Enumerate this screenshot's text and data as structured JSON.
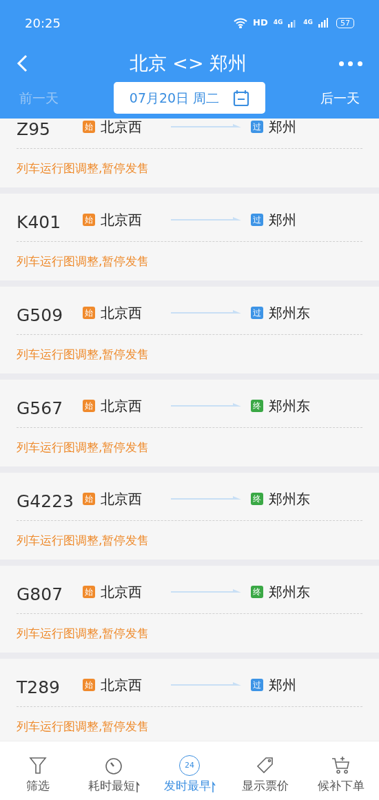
{
  "status_bar": {
    "time": "20:25",
    "hd": "HD",
    "network_1": "4G",
    "network_2": "4G",
    "battery": "57"
  },
  "header": {
    "title": "北京 <> 郑州"
  },
  "date_bar": {
    "prev": {
      "label": "前一天",
      "disabled": true
    },
    "date": "07月20日 周二",
    "next": {
      "label": "后一天",
      "disabled": false
    }
  },
  "trains": [
    {
      "number": "Z95",
      "from_badge": {
        "text": "始",
        "color": "#f08a2c"
      },
      "from": "北京西",
      "to_badge": {
        "text": "过",
        "color": "#3d94e6"
      },
      "to": "郑州",
      "note": "列车运行图调整,暂停发售"
    },
    {
      "number": "K401",
      "from_badge": {
        "text": "始",
        "color": "#f08a2c"
      },
      "from": "北京西",
      "to_badge": {
        "text": "过",
        "color": "#3d94e6"
      },
      "to": "郑州",
      "note": "列车运行图调整,暂停发售"
    },
    {
      "number": "G509",
      "from_badge": {
        "text": "始",
        "color": "#f08a2c"
      },
      "from": "北京西",
      "to_badge": {
        "text": "过",
        "color": "#3d94e6"
      },
      "to": "郑州东",
      "note": "列车运行图调整,暂停发售"
    },
    {
      "number": "G567",
      "from_badge": {
        "text": "始",
        "color": "#f08a2c"
      },
      "from": "北京西",
      "to_badge": {
        "text": "终",
        "color": "#3aa845"
      },
      "to": "郑州东",
      "note": "列车运行图调整,暂停发售"
    },
    {
      "number": "G4223",
      "from_badge": {
        "text": "始",
        "color": "#f08a2c"
      },
      "from": "北京西",
      "to_badge": {
        "text": "终",
        "color": "#3aa845"
      },
      "to": "郑州东",
      "note": "列车运行图调整,暂停发售"
    },
    {
      "number": "G807",
      "from_badge": {
        "text": "始",
        "color": "#f08a2c"
      },
      "from": "北京西",
      "to_badge": {
        "text": "终",
        "color": "#3aa845"
      },
      "to": "郑州东",
      "note": "列车运行图调整,暂停发售"
    },
    {
      "number": "T289",
      "from_badge": {
        "text": "始",
        "color": "#f08a2c"
      },
      "from": "北京西",
      "to_badge": {
        "text": "过",
        "color": "#3d94e6"
      },
      "to": "郑州",
      "note": "列车运行图调整,暂停发售"
    }
  ],
  "bottom_bar": [
    {
      "kind": "filter",
      "label": "筛选",
      "selected": false
    },
    {
      "kind": "duration",
      "label": "耗时最短",
      "selected": false
    },
    {
      "kind": "departure",
      "label": "发时最早",
      "icon_text": "24",
      "selected": true
    },
    {
      "kind": "price",
      "label": "显示票价",
      "selected": false
    },
    {
      "kind": "waitlist",
      "label": "候补下单",
      "selected": false
    }
  ]
}
